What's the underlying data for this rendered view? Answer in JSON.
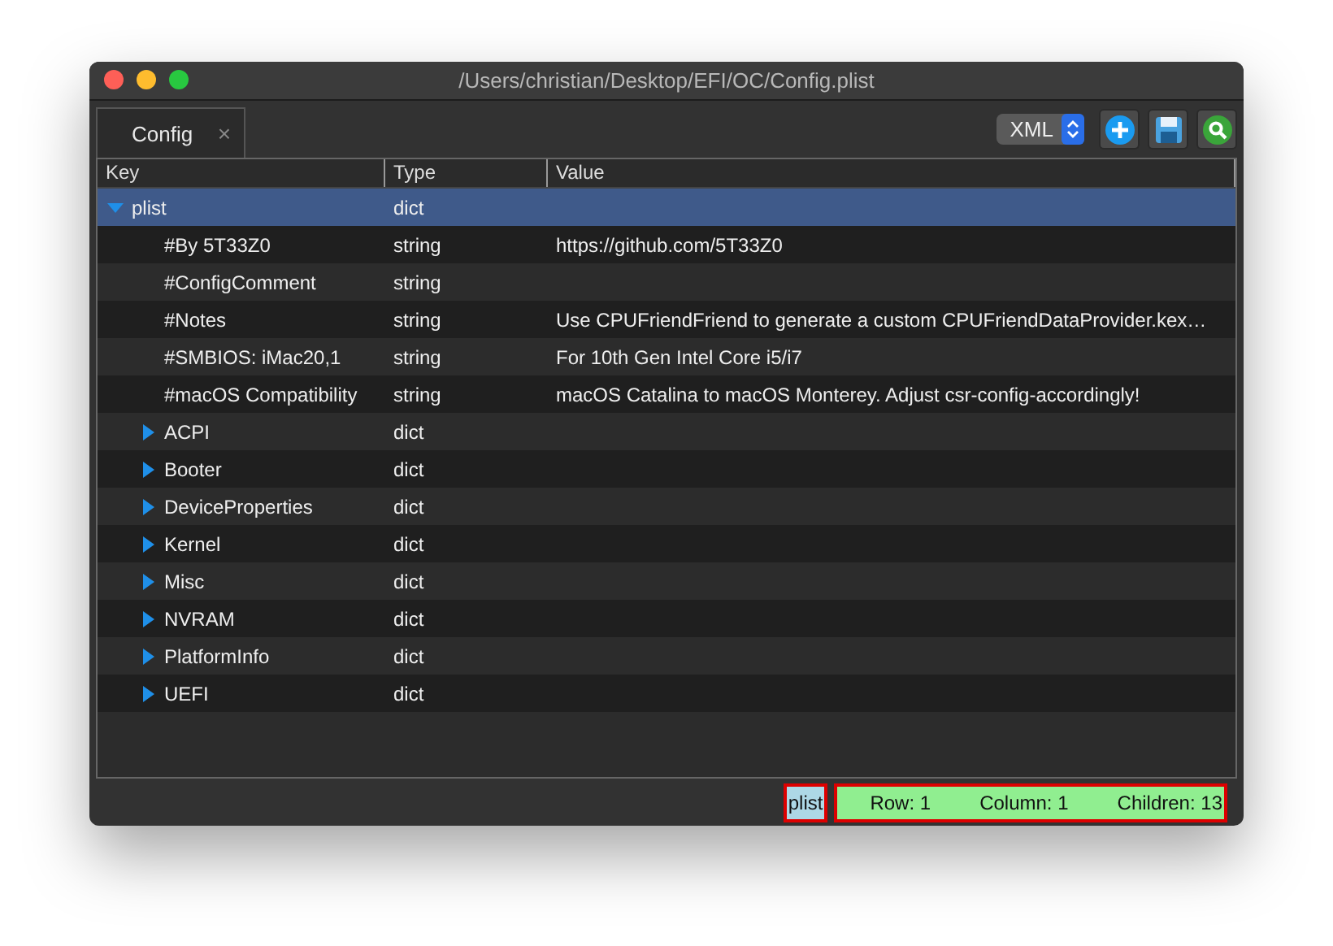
{
  "window": {
    "title": "/Users/christian/Desktop/EFI/OC/Config.plist"
  },
  "tabs": [
    {
      "label": "Config",
      "close": "×",
      "selected": true
    }
  ],
  "format": {
    "value": "XML"
  },
  "columns": [
    "Key",
    "Type",
    "Value"
  ],
  "tree": [
    {
      "key": "plist",
      "type": "dict",
      "kind": "branch",
      "expanded": true,
      "selected": true,
      "children": [
        {
          "key": "#By 5T33Z0",
          "type": "string",
          "value": "https://github.com/5T33Z0",
          "kind": "leaf",
          "selected": false
        },
        {
          "key": "#ConfigComment",
          "type": "string",
          "kind": "leaf",
          "selected": false
        },
        {
          "key": "#Notes",
          "type": "string",
          "value": "Use CPUFriendFriend to generate a custom CPUFriendDataProvider.kex…",
          "kind": "leaf",
          "selected": false
        },
        {
          "key": "#SMBIOS: iMac20,1",
          "type": "string",
          "value": "For 10th Gen Intel Core i5/i7",
          "kind": "leaf",
          "selected": false
        },
        {
          "key": "#macOS Compatibility",
          "type": "string",
          "value": "macOS Catalina to macOS Monterey. Adjust csr-config-accordingly!",
          "kind": "leaf",
          "selected": false
        },
        {
          "key": "ACPI",
          "type": "dict",
          "kind": "branch",
          "expanded": false,
          "selected": false
        },
        {
          "key": "Booter",
          "type": "dict",
          "kind": "branch",
          "expanded": false,
          "selected": false
        },
        {
          "key": "DeviceProperties",
          "type": "dict",
          "kind": "branch",
          "expanded": false,
          "selected": false
        },
        {
          "key": "Kernel",
          "type": "dict",
          "kind": "branch",
          "expanded": false,
          "selected": false
        },
        {
          "key": "Misc",
          "type": "dict",
          "kind": "branch",
          "expanded": false,
          "selected": false
        },
        {
          "key": "NVRAM",
          "type": "dict",
          "kind": "branch",
          "expanded": false,
          "selected": false
        },
        {
          "key": "PlatformInfo",
          "type": "dict",
          "kind": "branch",
          "expanded": false,
          "selected": false
        },
        {
          "key": "UEFI",
          "type": "dict",
          "kind": "branch",
          "expanded": false,
          "selected": false
        }
      ]
    }
  ],
  "status_bar": {
    "key": "plist",
    "row": "Row: 1",
    "column": "Column: 1",
    "children": "Children: 13"
  }
}
